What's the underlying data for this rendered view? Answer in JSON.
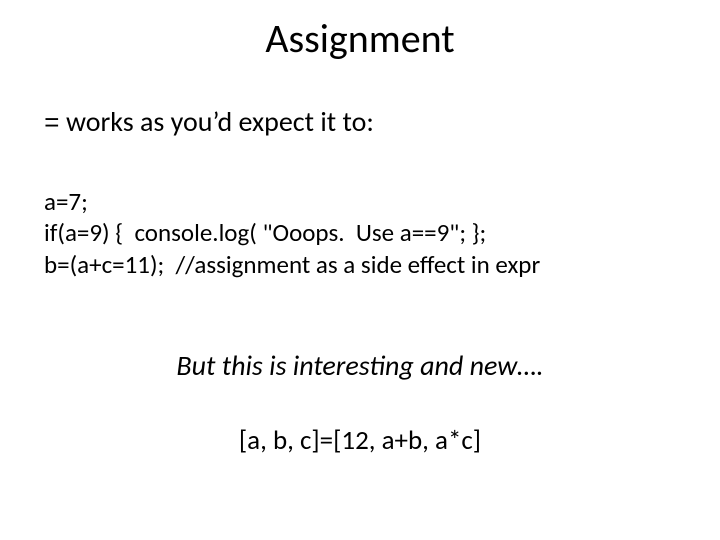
{
  "title": "Assignment",
  "intro": {
    "eq": "=",
    "text": "  works as you’d expect it to:"
  },
  "code": {
    "line1": "a=7;",
    "line2": "if(a=9) {  console.log( \"Ooops.  Use a==9\"; };",
    "line3": "b=(a+c=11);  //assignment as a side effect in expr"
  },
  "emphasis": "But this is interesting and new….",
  "destructuring": "[a, b, c]=[12, a+b, a*c]"
}
